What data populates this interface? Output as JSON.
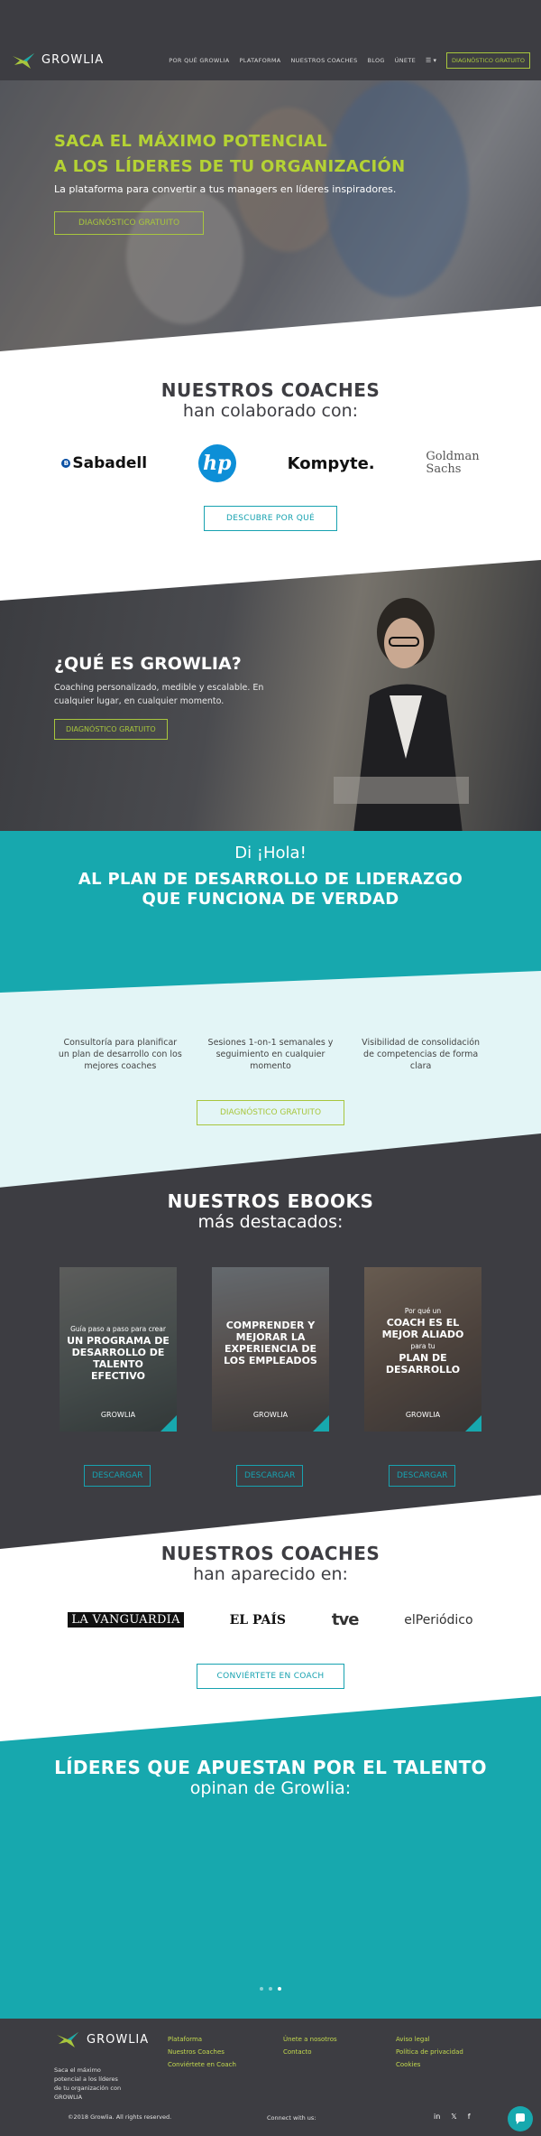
{
  "header": {
    "logo_text": "GROWLIA",
    "nav": [
      "POR QUÉ GROWLIA",
      "PLATAFORMA",
      "NUESTROS COACHES",
      "BLOG",
      "ÚNETE"
    ],
    "lang": "☰ ▾",
    "cta": "DIAGNÓSTICO GRATUITO"
  },
  "hero": {
    "title_line1": "SACA EL MÁXIMO POTENCIAL",
    "title_line2": "A LOS LÍDERES DE TU ORGANIZACIÓN",
    "subtitle": "La plataforma para convertir a tus managers en líderes inspiradores.",
    "cta": "DIAGNÓSTICO GRATUITO"
  },
  "coaches1": {
    "title": "NUESTROS COACHES",
    "subtitle": "han colaborado con:",
    "logos": [
      "Sabadell",
      "hp",
      "Kompyte.",
      "Goldman",
      "Sachs"
    ],
    "cta": "DESCUBRE POR QUÉ"
  },
  "what_is": {
    "title": "¿QUÉ ES GROWLIA?",
    "text": "Coaching personalizado, medible y escalable. En cualquier lugar, en cualquier momento.",
    "cta": "DIAGNÓSTICO GRATUITO"
  },
  "plan": {
    "greeting": "Di ¡Hola!",
    "title_line1": "AL PLAN DE DESARROLLO DE LIDERAZGO",
    "title_line2": "QUE FUNCIONA DE VERDAD",
    "features": [
      "Consultoría para planificar un plan de desarrollo con los mejores coaches",
      "Sesiones 1-on-1 semanales y seguimiento en cualquier momento",
      "Visibilidad de consolidación de competencias de forma clara"
    ],
    "cta": "DIAGNÓSTICO GRATUITO"
  },
  "ebooks": {
    "title": "NUESTROS EBOOKS",
    "subtitle": "más destacados:",
    "items": [
      {
        "small": "Guía paso a paso para crear",
        "title": "UN PROGRAMA DE DESARROLLO DE TALENTO EFECTIVO",
        "brand": "GROWLIA",
        "button": "DESCARGAR"
      },
      {
        "small": "",
        "title": "COMPRENDER Y MEJORAR LA EXPERIENCIA DE LOS EMPLEADOS",
        "brand": "GROWLIA",
        "button": "DESCARGAR"
      },
      {
        "small": "Por qué un",
        "title": "COACH ES EL MEJOR ALIADO",
        "small2": "para tu",
        "title2": "PLAN DE DESARROLLO",
        "brand": "GROWLIA",
        "button": "DESCARGAR"
      }
    ]
  },
  "coaches2": {
    "title": "NUESTROS COACHES",
    "subtitle": "han aparecido en:",
    "media": [
      "LA VANGUARDIA",
      "EL PAÍS",
      "tve",
      "elPeriódico"
    ],
    "cta": "CONVIÉRTETE EN COACH"
  },
  "testimonials": {
    "title": "LÍDERES QUE APUESTAN POR EL TALENTO",
    "subtitle": "opinan de Growlia:"
  },
  "footer": {
    "logo_text": "GROWLIA",
    "description": "Saca el máximo potencial a los líderes de tu organización con GROWLIA",
    "col1": [
      "Plataforma",
      "Nuestros Coaches",
      "Conviértete en Coach"
    ],
    "col2": [
      "Únete a nosotros",
      "Contacto"
    ],
    "col3": [
      "Aviso legal",
      "Política de privacidad",
      "Cookies"
    ],
    "copyright": "©2018 Growlia. All rights reserved.",
    "connect": "Connect with us:",
    "social": [
      "in",
      "𝕏",
      "f"
    ]
  },
  "colors": {
    "dark": "#3d3d42",
    "teal": "#17a8ae",
    "green": "#a8c63d"
  }
}
